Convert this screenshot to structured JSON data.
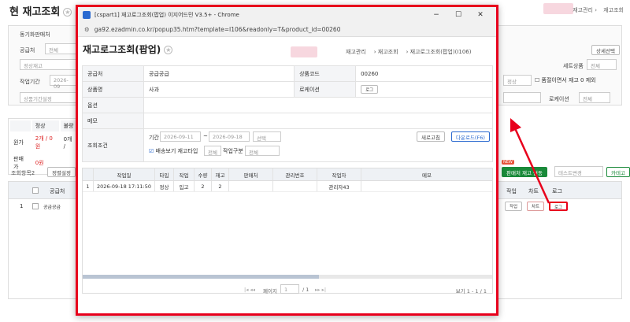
{
  "bg": {
    "title": "현 재고조회",
    "crumbs": [
      "재고관리",
      "재고조회"
    ],
    "filters": {
      "seller_label": "동기화판매처",
      "supplier_label": "공급처",
      "supplier_value": "전체",
      "stock_type_value": "정상재고",
      "period_label": "작업기간",
      "period_start": "2026-09",
      "product_period_placeholder": "상품기간설정",
      "set_product_label": "세트상품",
      "set_product_value": "전체",
      "status_value": "정상",
      "exclude_soldout_label": "품절이면서 재고 0 제외",
      "location_label": "로케이션",
      "location_value": "전체",
      "detail_select_btn": "상세선택"
    },
    "summary": {
      "col_normal": "정상",
      "col_bad": "불량",
      "row1_label": "원가",
      "row1_normal": "2개 / 0원",
      "row1_bad": "0개 /",
      "row2_label": "판매가",
      "row2_normal": "0원"
    },
    "toolbar": {
      "lookup_select": "조회항목2",
      "sort_btn": "정렬설정",
      "new_badge": "NEW",
      "sync_btn": "판매처 재고 연동",
      "test_change": "테스트변경",
      "category_btn": "카테고리"
    },
    "grid": {
      "col_supplier": "공급처",
      "col_work": "작업",
      "col_chart": "차트",
      "col_log": "로그",
      "row_no": "1",
      "row_supplier": "공급공급",
      "row_work_btn": "작업",
      "row_chart_btn": "차트",
      "row_log_btn": "로그"
    }
  },
  "popup": {
    "window_title": "[cspart1] 재고로그조회(팝업) 이지어드민 V3.5+ - Chrome",
    "url": "ga92.ezadmin.co.kr/popup35.htm?template=I106&readonly=T&product_id=00260",
    "title": "재고로그조회(팝업)",
    "crumbs": [
      "재고관리",
      "재고조회",
      "재고로그조회(팝업)(I106)"
    ],
    "info": {
      "supplier_label": "공급처",
      "supplier_value": "공급공급",
      "product_code_label": "상품코드",
      "product_code_value": "00260",
      "product_name_label": "상품명",
      "product_name_value": "사과",
      "location_label": "로케이션",
      "location_btn": "로그",
      "option_label": "옵션",
      "memo_label": "메모",
      "query_label": "조회조건",
      "period_label": "기간",
      "date_from": "2026-09-11",
      "date_to": "2026-09-18",
      "select_placeholder": "선택",
      "refresh_btn": "새로고침",
      "download_btn": "다운로드(F6)",
      "delivery_check_label": "배송보기 재고타입",
      "delivery_type_value": "전체",
      "work_type_label": "작업구분",
      "work_type_value": "전체"
    },
    "table": {
      "headers": [
        "작업일",
        "타입",
        "작업",
        "수량",
        "재고",
        "판매처",
        "관리번호",
        "작업자",
        "메모"
      ],
      "rows": [
        {
          "no": "1",
          "date": "2026-09-18 17:11:50",
          "type": "정상",
          "work": "입고",
          "qty": "2",
          "stock": "2",
          "seller": "",
          "mgmt": "",
          "worker": "관리자43",
          "memo": ""
        }
      ]
    },
    "pager": {
      "page_label": "페이지",
      "page_value": "1",
      "page_total": "/ 1",
      "view_info": "보기 1 - 1 / 1"
    }
  },
  "colors": {
    "highlight": "#e8001c",
    "green": "#1a8a3a"
  }
}
